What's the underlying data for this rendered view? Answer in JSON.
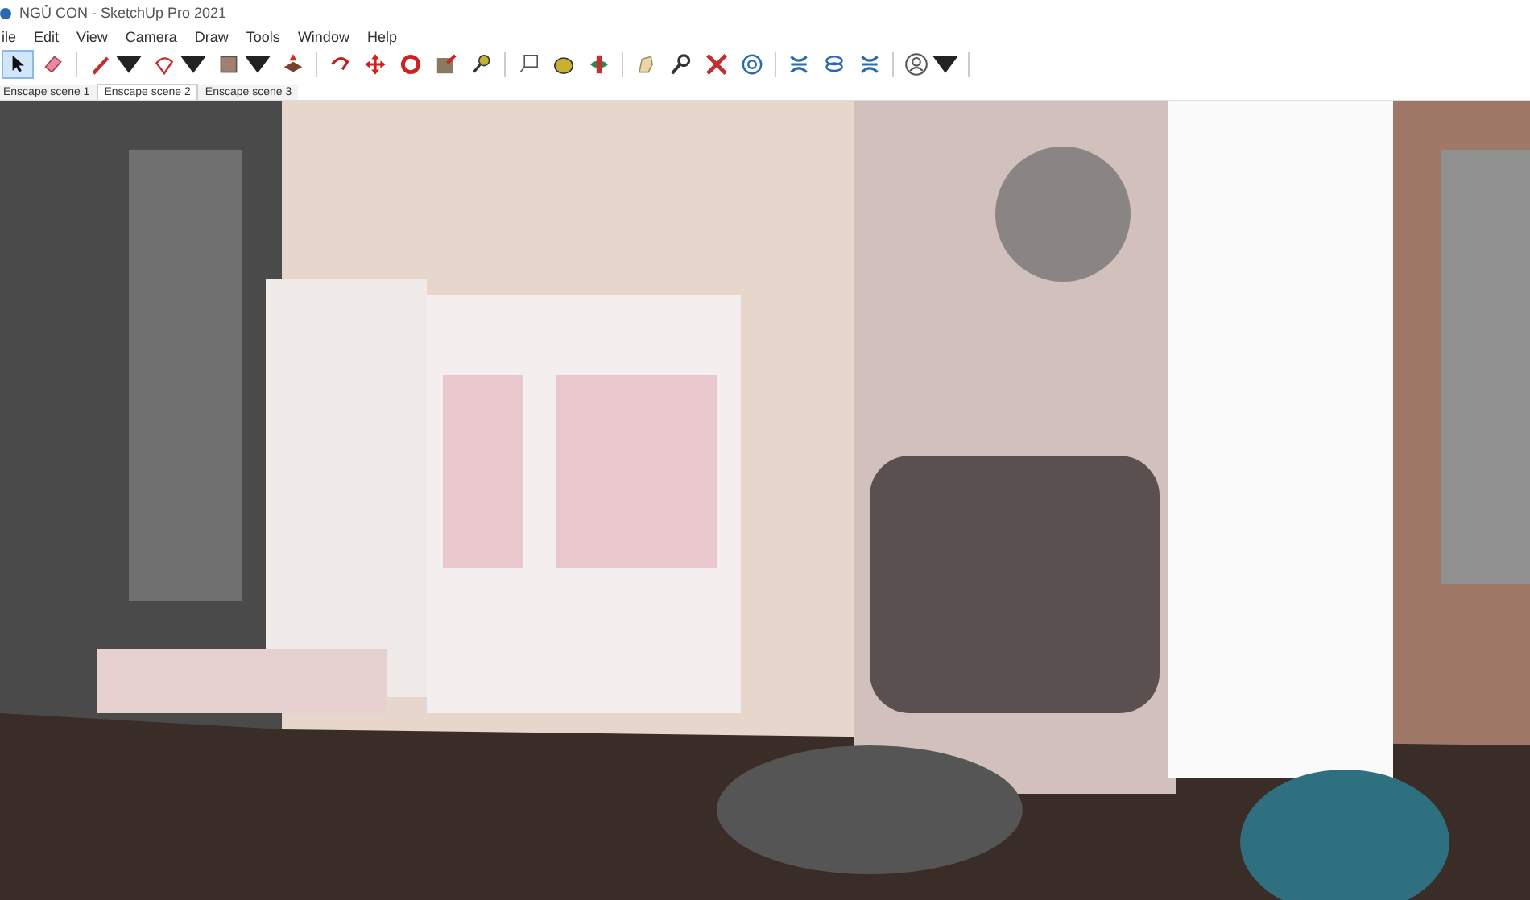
{
  "window": {
    "title": "NGỦ CON - SketchUp Pro 2021"
  },
  "menu": [
    "ile",
    "Edit",
    "View",
    "Camera",
    "Draw",
    "Tools",
    "Window",
    "Help"
  ],
  "toolbar": [
    {
      "kind": "select",
      "selected": true,
      "dropdown": false
    },
    {
      "kind": "eraser",
      "selected": false,
      "dropdown": false
    },
    {
      "kind": "pencil",
      "selected": false,
      "dropdown": true
    },
    {
      "kind": "arc",
      "selected": false,
      "dropdown": true
    },
    {
      "kind": "rectangle",
      "selected": false,
      "dropdown": true
    },
    {
      "kind": "pushpull",
      "selected": false,
      "dropdown": false
    },
    {
      "kind": "followme",
      "selected": false,
      "dropdown": false
    },
    {
      "kind": "move",
      "selected": false,
      "dropdown": false
    },
    {
      "kind": "rotate",
      "selected": false,
      "dropdown": false
    },
    {
      "kind": "scale",
      "selected": false,
      "dropdown": false
    },
    {
      "kind": "tape",
      "selected": false,
      "dropdown": false
    },
    {
      "kind": "text",
      "selected": false,
      "dropdown": false
    },
    {
      "kind": "paint",
      "selected": false,
      "dropdown": false
    },
    {
      "kind": "orbit",
      "selected": false,
      "dropdown": false
    },
    {
      "kind": "pan",
      "selected": false,
      "dropdown": false
    },
    {
      "kind": "zoom",
      "selected": false,
      "dropdown": false
    },
    {
      "kind": "extents",
      "selected": false,
      "dropdown": false
    },
    {
      "kind": "target",
      "selected": false,
      "dropdown": false
    },
    {
      "kind": "cross",
      "selected": false,
      "dropdown": false
    },
    {
      "kind": "layers",
      "selected": false,
      "dropdown": false
    },
    {
      "kind": "cross",
      "selected": false,
      "dropdown": false
    },
    {
      "kind": "user",
      "selected": false,
      "dropdown": true
    }
  ],
  "scene_tabs": [
    {
      "label": "Enscape scene 1",
      "selected": false
    },
    {
      "label": "Enscape scene 2",
      "selected": true
    },
    {
      "label": "Enscape scene 3",
      "selected": false
    }
  ]
}
